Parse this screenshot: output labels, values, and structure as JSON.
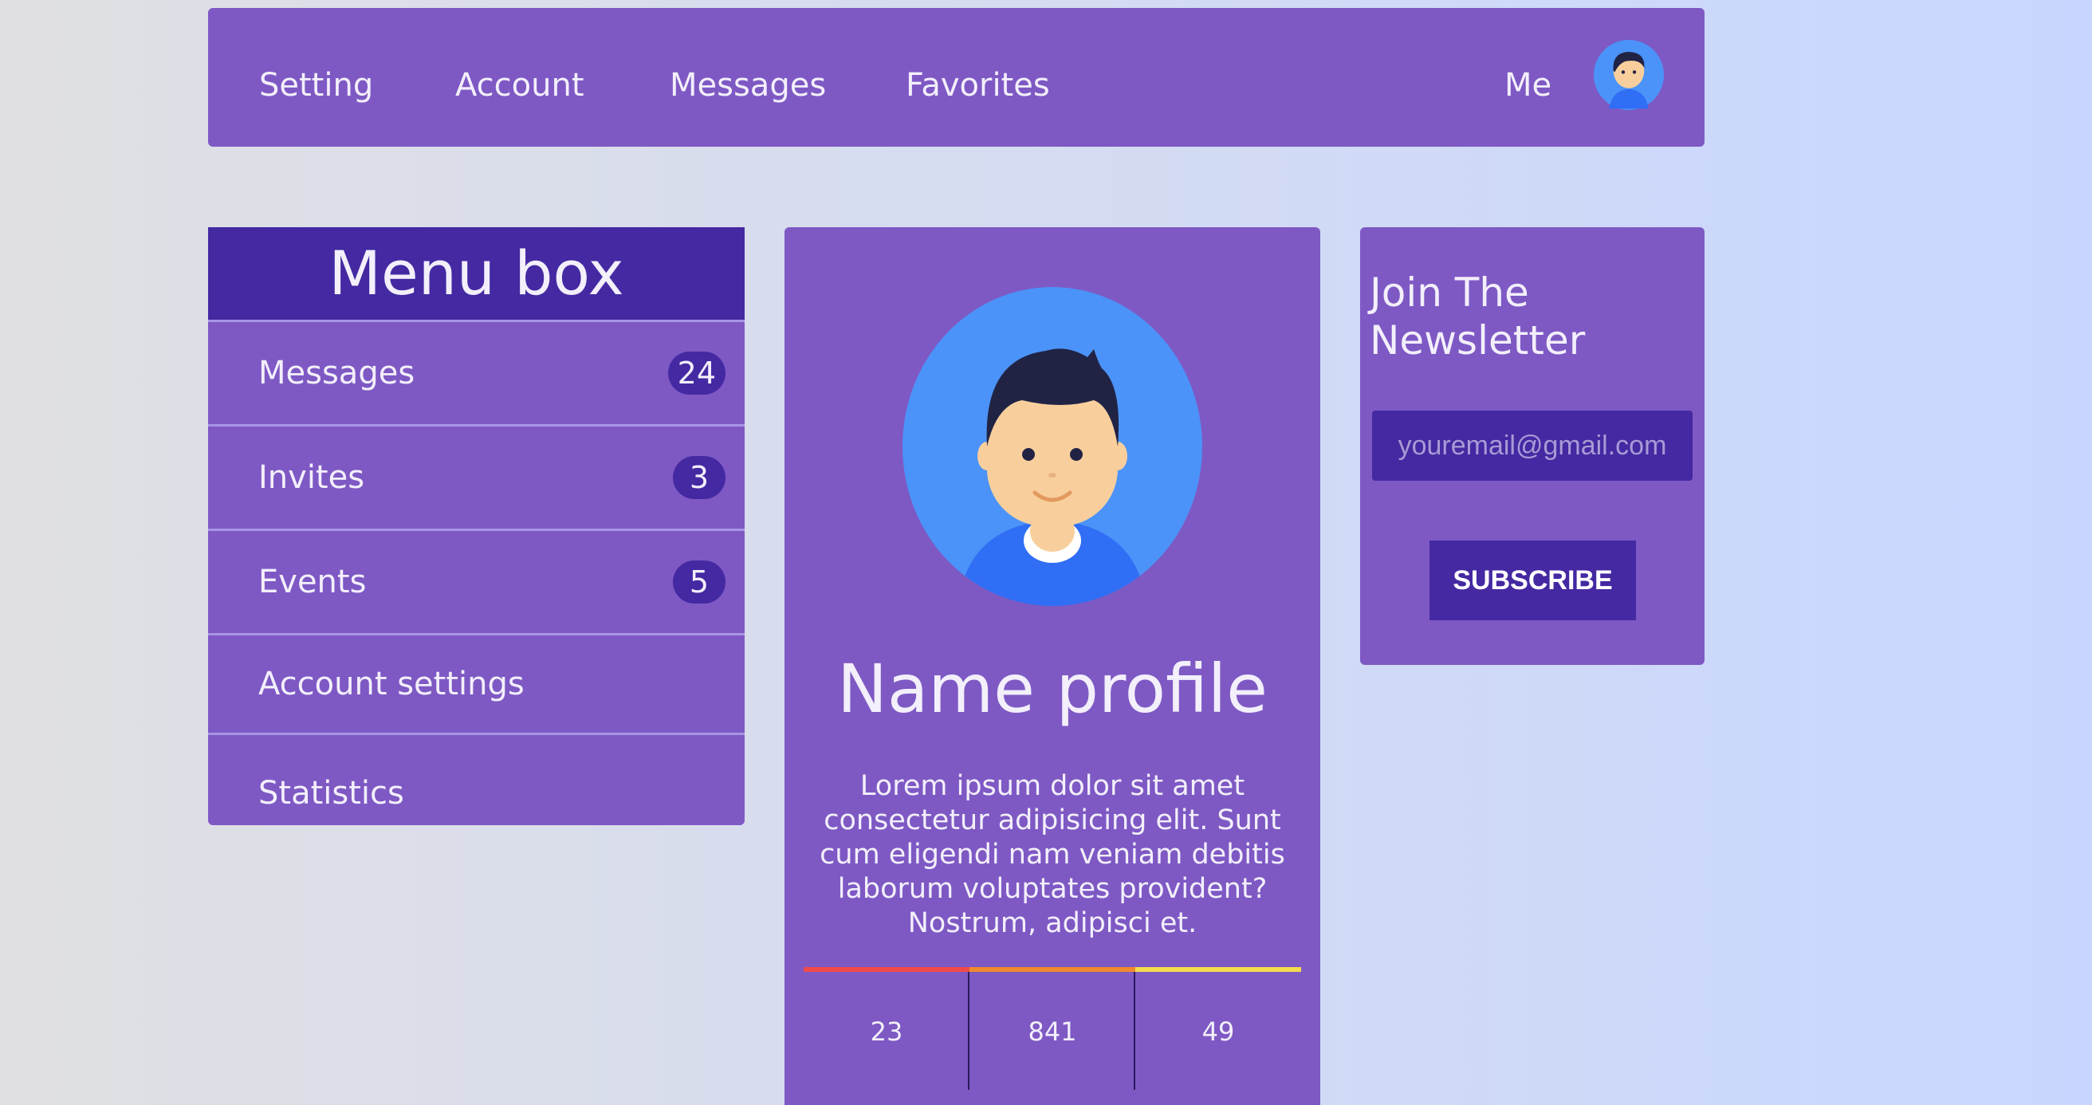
{
  "nav": {
    "items": [
      {
        "label": "Setting"
      },
      {
        "label": "Account"
      },
      {
        "label": "Messages"
      },
      {
        "label": "Favorites"
      }
    ],
    "me_label": "Me",
    "avatar_icon": "user-avatar-icon"
  },
  "menu": {
    "title": "Menu box",
    "items": [
      {
        "label": "Messages",
        "badge": "24"
      },
      {
        "label": "Invites",
        "badge": "3"
      },
      {
        "label": "Events",
        "badge": "5"
      },
      {
        "label": "Account settings"
      },
      {
        "label": "Statistics"
      }
    ]
  },
  "profile": {
    "name": "Name profile",
    "description": "Lorem ipsum dolor sit amet consectetur adipisicing elit. Sunt cum eligendi nam veniam debitis laborum voluptates provident? Nostrum, adipisci et.",
    "stats": [
      {
        "value": "23",
        "color": "#ef4a4a"
      },
      {
        "value": "841",
        "color": "#f08a2c"
      },
      {
        "value": "49",
        "color": "#f5dc4a"
      }
    ]
  },
  "newsletter": {
    "title": "Join The Newsletter",
    "email_placeholder": "youremail@gmail.com",
    "button_label": "SUBSCRIBE"
  },
  "colors": {
    "panel": "#7e59c4",
    "accent_dark": "#4429a2"
  }
}
